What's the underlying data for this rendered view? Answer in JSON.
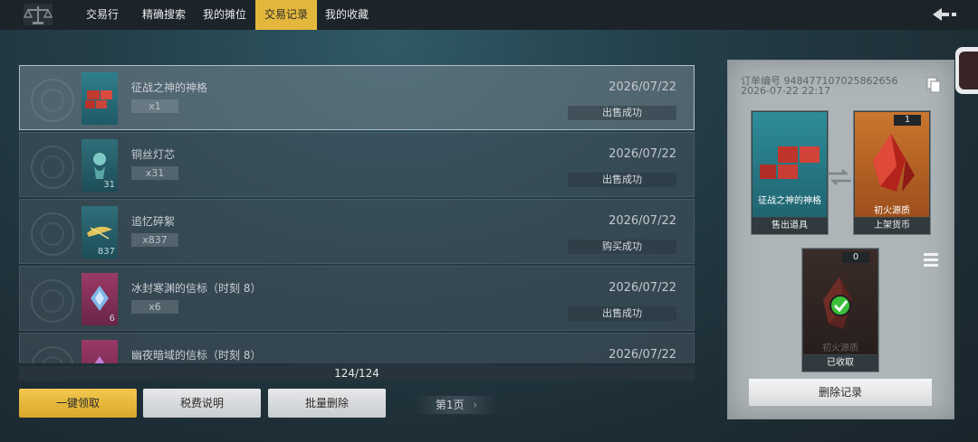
{
  "nav": {
    "tabs": [
      {
        "label": "交易行",
        "active": false
      },
      {
        "label": "精确搜索",
        "active": false
      },
      {
        "label": "我的摊位",
        "active": false
      },
      {
        "label": "交易记录",
        "active": true
      },
      {
        "label": "我的收藏",
        "active": false
      }
    ],
    "back_icon": "back-arrow-icon"
  },
  "records": [
    {
      "name": "征战之神的神格",
      "count": "x1",
      "date": "2026/07/22",
      "status": "出售成功",
      "thumb_qty": "",
      "selected": true
    },
    {
      "name": "铜丝灯芯",
      "count": "x31",
      "date": "2026/07/22",
      "status": "出售成功",
      "thumb_qty": "31",
      "selected": false
    },
    {
      "name": "追忆碎絮",
      "count": "x837",
      "date": "2026/07/22",
      "status": "购买成功",
      "thumb_qty": "837",
      "selected": false
    },
    {
      "name": "冰封寒渊的信标（时刻 8）",
      "count": "x6",
      "date": "2026/07/22",
      "status": "出售成功",
      "thumb_qty": "6",
      "selected": false
    },
    {
      "name": "幽夜暗域的信标（时刻 8）",
      "count": "",
      "date": "2026/07/22",
      "status": "",
      "thumb_qty": "",
      "selected": false
    }
  ],
  "list_counter": "124/124",
  "actions": {
    "claim_all": "一键领取",
    "tax_info": "税费说明",
    "batch_delete": "批量删除",
    "page": "第1页"
  },
  "detail": {
    "order_no": "订单编号 948477107025862656",
    "order_time": "2026-07-22 22:17",
    "sold_item": {
      "title": "征战之神的神格",
      "caption": "售出道具"
    },
    "currency": {
      "title": "初火源质",
      "caption": "上架货币",
      "count": "1"
    },
    "received": {
      "title": "初火源质",
      "caption": "已收取",
      "count": "0"
    },
    "delete_label": "删除记录"
  },
  "colors": {
    "accent_gold": "#e2b73c",
    "panel": "#aeb5b8",
    "success_green": "#3bbf3b"
  }
}
